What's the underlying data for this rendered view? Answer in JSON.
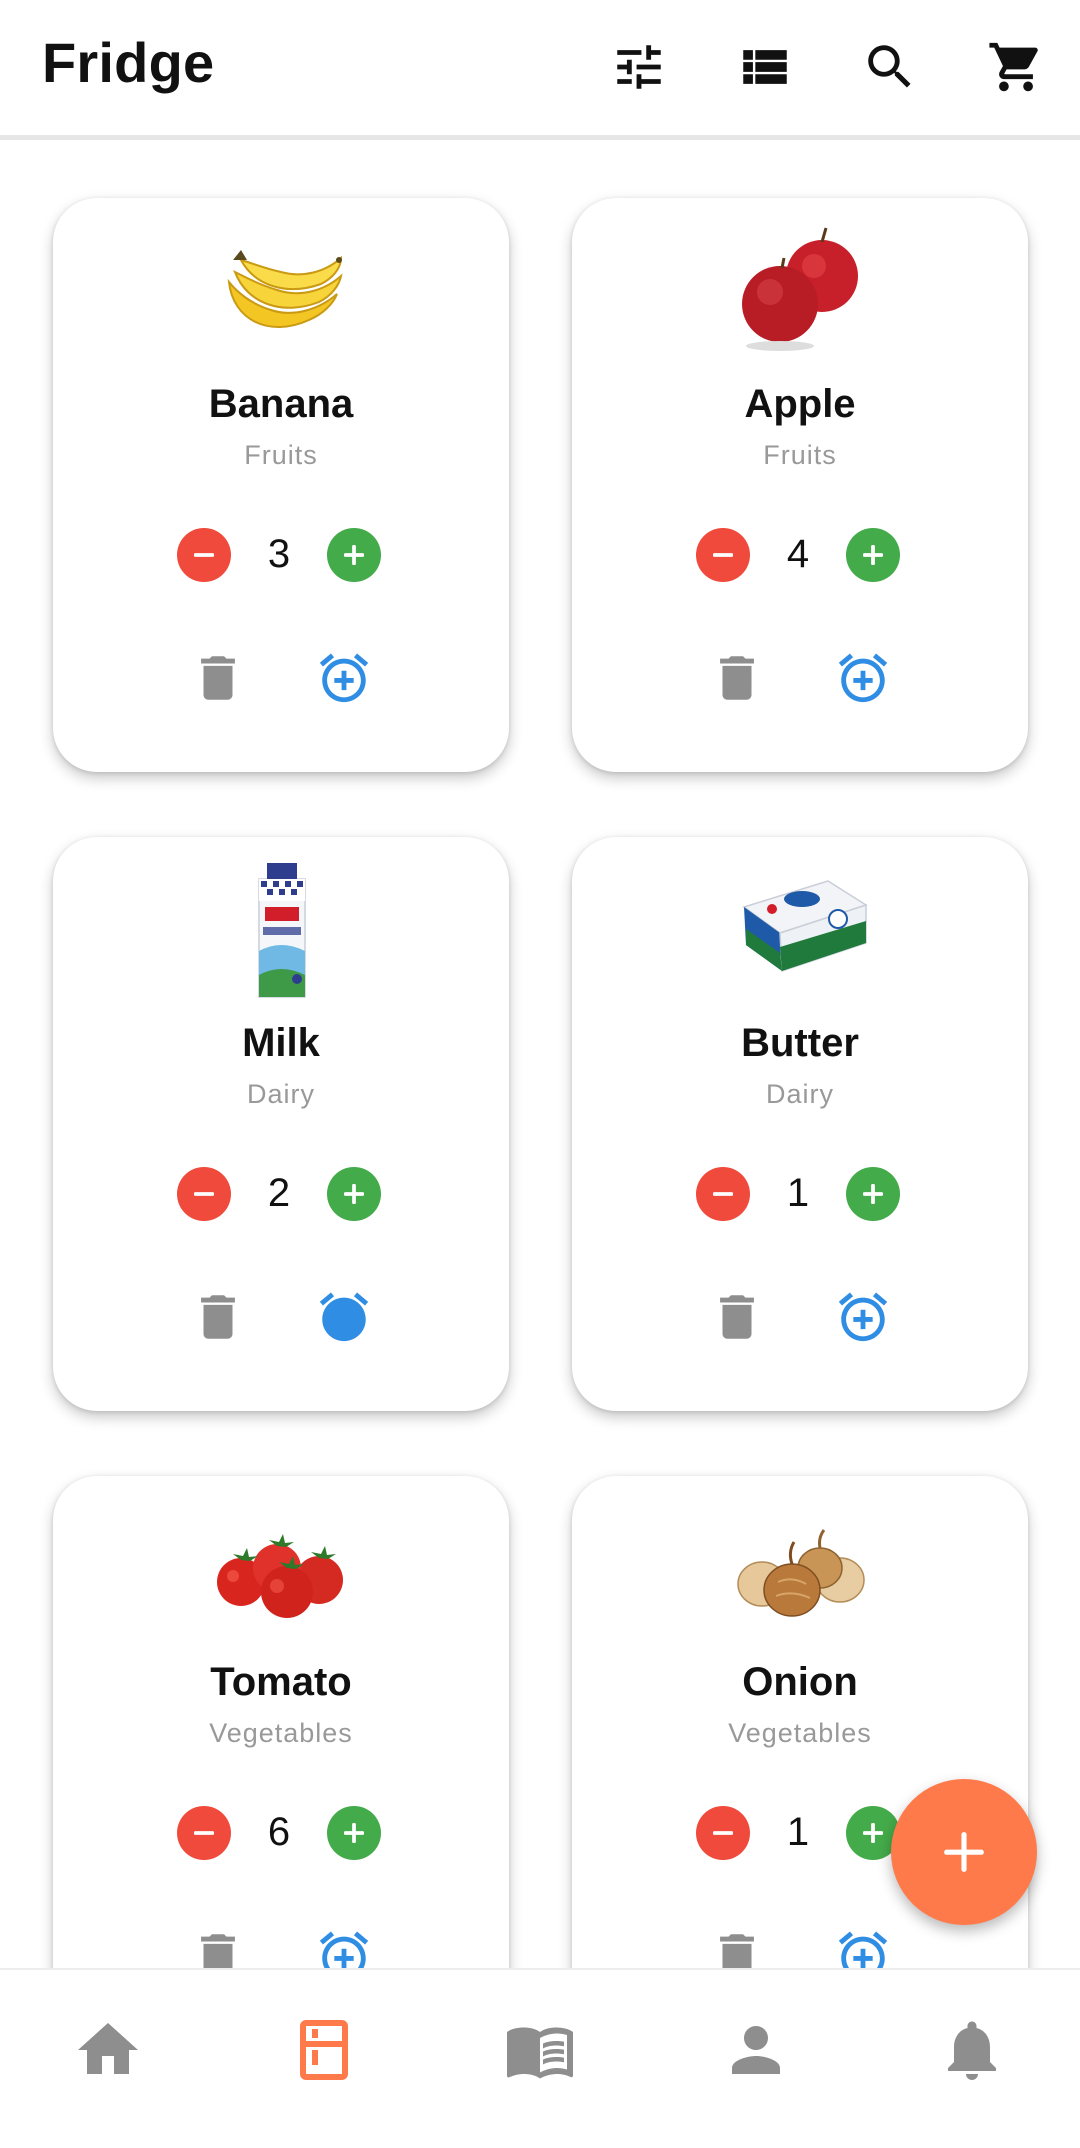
{
  "app": {
    "title": "Fridge"
  },
  "appbar": {
    "actions": [
      "filter-icon",
      "view-list-icon",
      "search-icon",
      "cart-icon"
    ]
  },
  "colors": {
    "accent": "#ff7a4a",
    "minus": "#f04a3c",
    "plus": "#44ab4a",
    "alarm": "#2f8de4",
    "inactive_icon": "#8e8e8e"
  },
  "items": [
    {
      "name": "Banana",
      "category": "Fruits",
      "quantity": "3",
      "image": "banana"
    },
    {
      "name": "Apple",
      "category": "Fruits",
      "quantity": "4",
      "image": "apple"
    },
    {
      "name": "Milk",
      "category": "Dairy",
      "quantity": "2",
      "image": "milk-carton"
    },
    {
      "name": "Butter",
      "category": "Dairy",
      "quantity": "1",
      "image": "butter-package"
    },
    {
      "name": "Tomato",
      "category": "Vegetables",
      "quantity": "6",
      "image": "tomatoes"
    },
    {
      "name": "Onion",
      "category": "Vegetables",
      "quantity": "1",
      "image": "onions"
    }
  ],
  "fab": {
    "icon": "plus-icon"
  },
  "bottom_nav": {
    "items": [
      {
        "icon": "home-icon",
        "active": false
      },
      {
        "icon": "fridge-icon",
        "active": true
      },
      {
        "icon": "book-icon",
        "active": false
      },
      {
        "icon": "person-icon",
        "active": false
      },
      {
        "icon": "bell-icon",
        "active": false
      }
    ]
  }
}
